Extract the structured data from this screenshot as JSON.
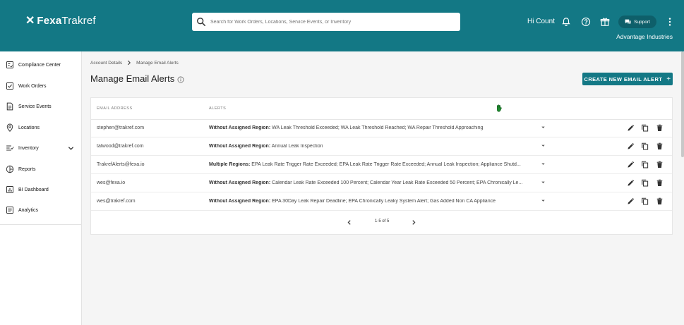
{
  "header": {
    "logo": {
      "x_glyph": "✕",
      "brand1": "Fexa",
      "brand2": "Trakref"
    },
    "search_placeholder": "Search for Work Orders, Locations, Service Events, or Inventory",
    "greeting": "Hi Count",
    "support_label": "Support",
    "company": "Advantage Industries",
    "background_color": "#137885"
  },
  "sidebar": {
    "items": [
      {
        "label": "Compliance Center",
        "icon": "compliance-icon"
      },
      {
        "label": "Work Orders",
        "icon": "checkbox-icon"
      },
      {
        "label": "Service Events",
        "icon": "document-icon"
      },
      {
        "label": "Locations",
        "icon": "location-pin-icon"
      },
      {
        "label": "Inventory",
        "icon": "inventory-icon"
      },
      {
        "label": "Reports",
        "icon": "reports-icon"
      },
      {
        "label": "BI Dashboard",
        "icon": "bar-chart-icon"
      },
      {
        "label": "Analytics",
        "icon": "analytics-icon"
      }
    ]
  },
  "breadcrumb": {
    "parent": "Account Details",
    "current": "Manage Email Alerts"
  },
  "page": {
    "title": "Manage Email Alerts",
    "create_button": "CREATE NEW EMAIL ALERT",
    "create_plus": "+",
    "accent_color": "#137885"
  },
  "table": {
    "headers": {
      "email": "EMAIL ADDRESS",
      "alerts": "ALERTS"
    },
    "rows": [
      {
        "email": "stephen@trakref.com",
        "region": "Without Assigned Region:",
        "alerts": "WA Leak Threshold Exceeded; WA Leak Threshold Reached; WA Repair Threshold Approaching"
      },
      {
        "email": "tatwood@trakref.com",
        "region": "Without Assigned Region:",
        "alerts": "Annual Leak Inspection"
      },
      {
        "email": "TrakrefAlerts@fexa.io",
        "region": "Multiple Regions:",
        "alerts": "EPA Leak Rate Trigger Rate Exceeded; EPA Leak Rate Trigger Rate Exceeded; Annual Leak Inspection; Appliance Shutd..."
      },
      {
        "email": "wes@fexa.io",
        "region": "Without Assigned Region:",
        "alerts": "Calendar Leak Rate Exceeded 100 Percent; Calendar Year Leak Rate Exceeded 50 Percent; EPA Chronically Le..."
      },
      {
        "email": "wes@trakref.com",
        "region": "Without Assigned Region:",
        "alerts": "EPA 30Day Leak Repair Deadline; EPA Chronically Leaky System Alert; Gas Added Non CA Appliance"
      }
    ],
    "pagination": "1-5 of 5"
  }
}
